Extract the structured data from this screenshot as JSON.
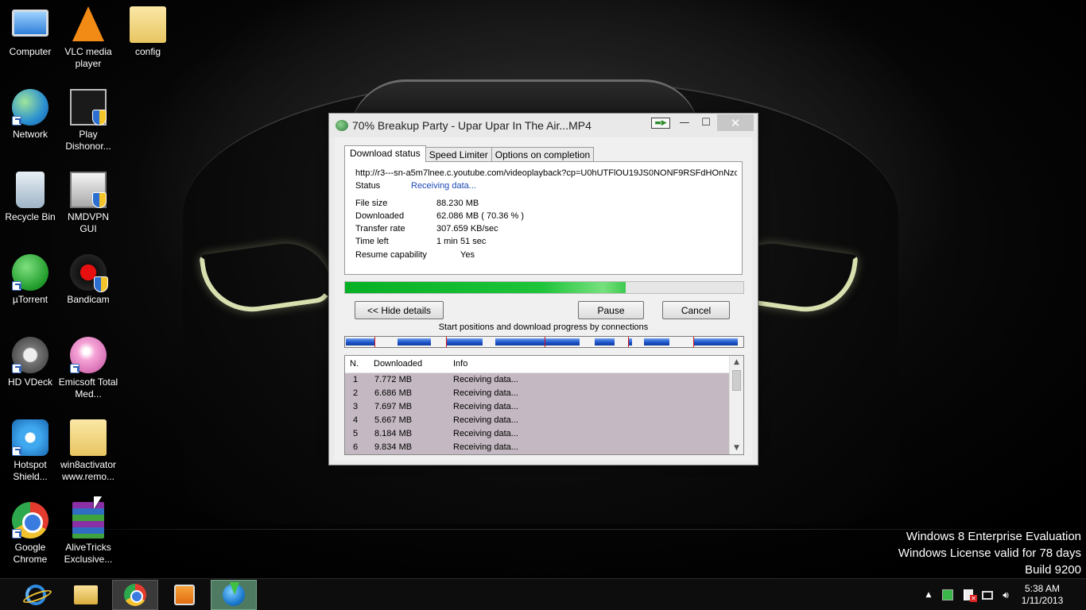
{
  "desktop": {
    "icons": [
      {
        "label": "Computer"
      },
      {
        "label": "VLC media player"
      },
      {
        "label": "config"
      },
      {
        "label": "Network"
      },
      {
        "label": "Play Dishonor..."
      },
      {
        "label": "Recycle Bin"
      },
      {
        "label": "NMDVPN GUI"
      },
      {
        "label": "µTorrent"
      },
      {
        "label": "Bandicam"
      },
      {
        "label": "HD VDeck"
      },
      {
        "label": "Emicsoft Total Med..."
      },
      {
        "label": "Hotspot Shield..."
      },
      {
        "label": "win8activator www.remo..."
      },
      {
        "label": "Google Chrome"
      },
      {
        "label": "AliveTricks Exclusive..."
      }
    ],
    "watermark": {
      "line1": "Windows 8 Enterprise Evaluation",
      "line2": "Windows License valid for 78 days",
      "line3": "Build 9200"
    }
  },
  "dialog": {
    "title": "70% Breakup Party - Upar Upar In The Air...MP4",
    "tabs": [
      "Download status",
      "Speed Limiter",
      "Options on completion"
    ],
    "url": "http://r3---sn-a5m7lnee.c.youtube.com/videoplayback?cp=U0hUTFlOU19JS0NONF9RSFdHOnNzc",
    "status_label": "Status",
    "status_value": "Receiving data...",
    "file_size_label": "File size",
    "file_size_value": "88.230  MB",
    "downloaded_label": "Downloaded",
    "downloaded_value": "62.086  MB  ( 70.36 % )",
    "transfer_rate_label": "Transfer rate",
    "transfer_rate_value": "307.659  KB/sec",
    "time_left_label": "Time left",
    "time_left_value": "1 min 51 sec",
    "resume_label": "Resume capability",
    "resume_value": "Yes",
    "progress_fraction": 0.7036,
    "buttons": {
      "hide_details": "<< Hide details",
      "pause": "Pause",
      "cancel": "Cancel"
    },
    "connections_caption": "Start positions and download progress by connections",
    "table": {
      "headers": [
        "N.",
        "Downloaded",
        "Info"
      ],
      "rows": [
        {
          "n": "1",
          "downloaded": "7.772  MB",
          "info": "Receiving data..."
        },
        {
          "n": "2",
          "downloaded": "6.686  MB",
          "info": "Receiving data..."
        },
        {
          "n": "3",
          "downloaded": "7.697  MB",
          "info": "Receiving data..."
        },
        {
          "n": "4",
          "downloaded": "5.667  MB",
          "info": "Receiving data..."
        },
        {
          "n": "5",
          "downloaded": "8.184  MB",
          "info": "Receiving data..."
        },
        {
          "n": "6",
          "downloaded": "9.834  MB",
          "info": "Receiving data..."
        }
      ]
    }
  },
  "taskbar": {
    "clock_time": "5:38 AM",
    "clock_date": "1/11/2013"
  }
}
